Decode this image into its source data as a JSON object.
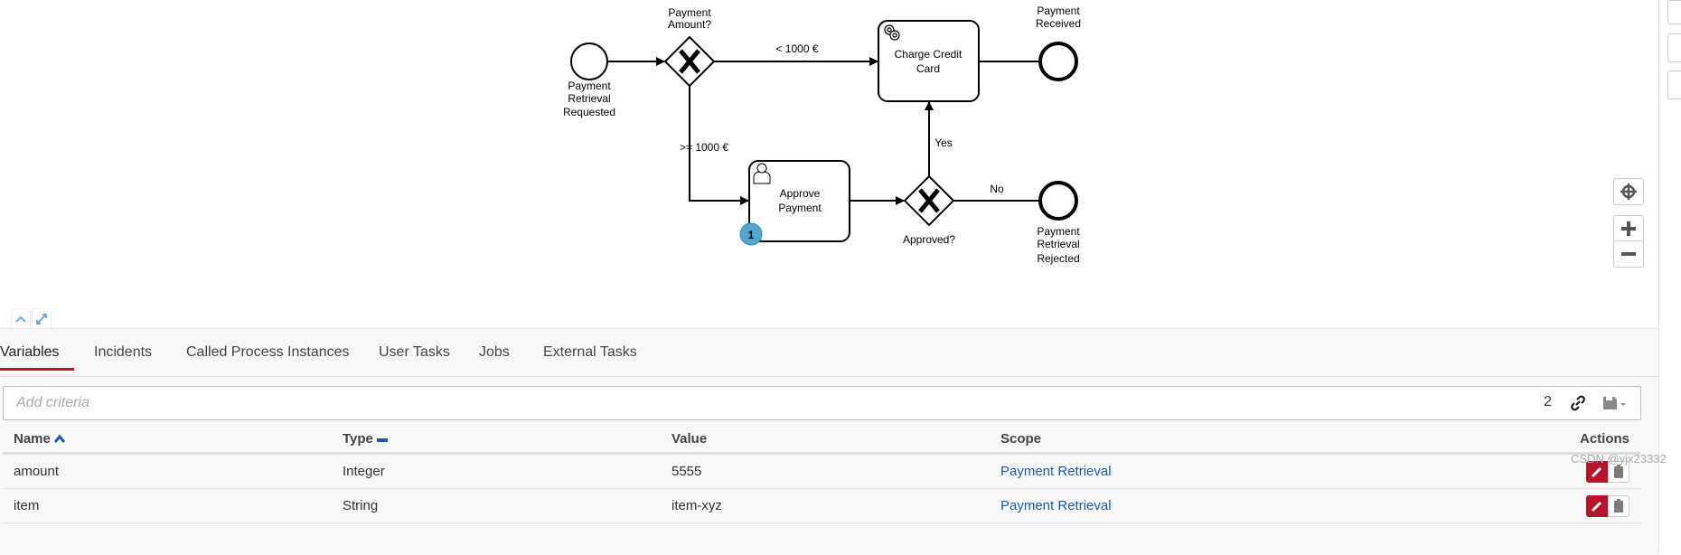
{
  "diagram": {
    "start_event": {
      "label_lines": [
        "Payment",
        "Retrieval",
        "Requested"
      ]
    },
    "gateway_amount": {
      "label_lines": [
        "Payment",
        "Amount?"
      ]
    },
    "flow_lt": "< 1000 €",
    "flow_ge": ">= 1000 €",
    "task_charge": {
      "label_lines": [
        "Charge Credit",
        "Card"
      ],
      "icon": "gear-icon"
    },
    "task_approve": {
      "label_lines": [
        "Approve",
        "Payment"
      ],
      "icon": "user-icon",
      "badge": "1"
    },
    "gateway_approved": {
      "label": "Approved?"
    },
    "flow_yes": "Yes",
    "flow_no": "No",
    "end_received": {
      "label_lines": [
        "Payment",
        "Received"
      ]
    },
    "end_rejected": {
      "label_lines": [
        "Payment",
        "Retrieval",
        "Rejected"
      ]
    },
    "colors": {
      "badge": "#52a7d1",
      "stroke": "#000000"
    }
  },
  "tabs": [
    {
      "label": "Variables",
      "active": true
    },
    {
      "label": "Incidents"
    },
    {
      "label": "Called Process Instances"
    },
    {
      "label": "User Tasks"
    },
    {
      "label": "Jobs"
    },
    {
      "label": "External Tasks"
    }
  ],
  "filter": {
    "placeholder": "Add criteria",
    "count": "2"
  },
  "table": {
    "headers": {
      "name": "Name",
      "type": "Type",
      "value": "Value",
      "scope": "Scope",
      "actions": "Actions"
    },
    "rows": [
      {
        "name": "amount",
        "type": "Integer",
        "value": "5555",
        "scope": "Payment Retrieval"
      },
      {
        "name": "item",
        "type": "String",
        "value": "item-xyz",
        "scope": "Payment Retrieval"
      }
    ]
  },
  "colors": {
    "accent": "#b5152b",
    "link": "#1a5bb8"
  },
  "watermark": "CSDN @yjx23332"
}
